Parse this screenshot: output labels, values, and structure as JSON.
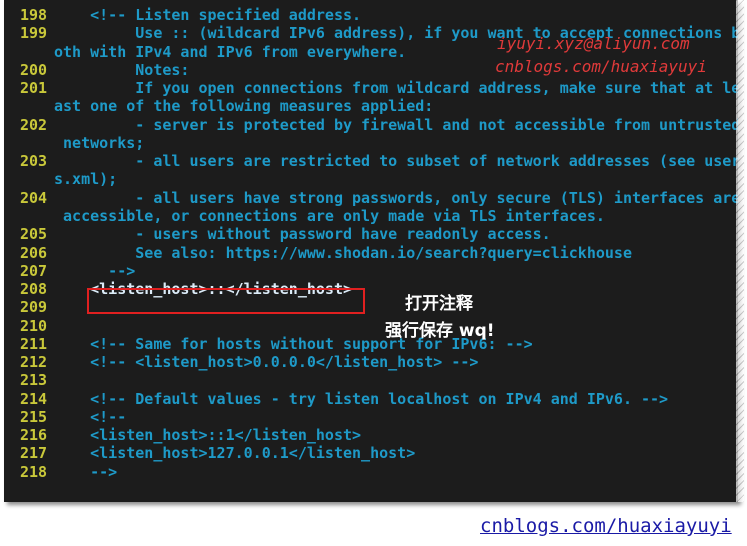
{
  "editor": {
    "lines": [
      {
        "num": "198",
        "text": "    <!-- Listen specified address."
      },
      {
        "num": "199",
        "text": "         Use :: (wildcard IPv6 address), if you want to accept connections b"
      },
      {
        "num": "",
        "text": "oth with IPv4 and IPv6 from everywhere."
      },
      {
        "num": "200",
        "text": "         Notes:"
      },
      {
        "num": "201",
        "text": "         If you open connections from wildcard address, make sure that at le"
      },
      {
        "num": "",
        "text": "ast one of the following measures applied:"
      },
      {
        "num": "202",
        "text": "         - server is protected by firewall and not accessible from untrusted"
      },
      {
        "num": "",
        "text": " networks;"
      },
      {
        "num": "203",
        "text": "         - all users are restricted to subset of network addresses (see users"
      },
      {
        "num": "",
        "text": "s.xml);"
      },
      {
        "num": "204",
        "text": "         - all users have strong passwords, only secure (TLS) interfaces are"
      },
      {
        "num": "",
        "text": " accessible, or connections are only made via TLS interfaces."
      },
      {
        "num": "205",
        "text": "         - users without password have readonly access."
      },
      {
        "num": "206",
        "text": "         See also: https://www.shodan.io/search?query=clickhouse"
      },
      {
        "num": "207",
        "text": "      -->"
      },
      {
        "num": "208",
        "text": "    <listen_host>::</listen_host>",
        "highlight": true
      },
      {
        "num": "209",
        "text": ""
      },
      {
        "num": "210",
        "text": ""
      },
      {
        "num": "211",
        "text": "    <!-- Same for hosts without support for IPv6: -->"
      },
      {
        "num": "212",
        "text": "    <!-- <listen_host>0.0.0.0</listen_host> -->"
      },
      {
        "num": "213",
        "text": ""
      },
      {
        "num": "214",
        "text": "    <!-- Default values - try listen localhost on IPv4 and IPv6. -->"
      },
      {
        "num": "215",
        "text": "    <!--"
      },
      {
        "num": "216",
        "text": "    <listen_host>::1</listen_host>"
      },
      {
        "num": "217",
        "text": "    <listen_host>127.0.0.1</listen_host>"
      },
      {
        "num": "218",
        "text": "    -->"
      }
    ]
  },
  "annotation": {
    "line1": "打开注释",
    "line2": "强行保存 wq!"
  },
  "watermark": {
    "email": "iyuyi.xyz@aliyun.com",
    "site": "cnblogs.com/huaxiayuyi"
  },
  "footer": {
    "link": "cnblogs.com/huaxiayuyi"
  },
  "colors": {
    "background": "#1c1c1c",
    "line_number": "#c9c83a",
    "comment": "#1e9ac8",
    "highlight_box": "#e02020",
    "watermark": "#e03a3a"
  }
}
